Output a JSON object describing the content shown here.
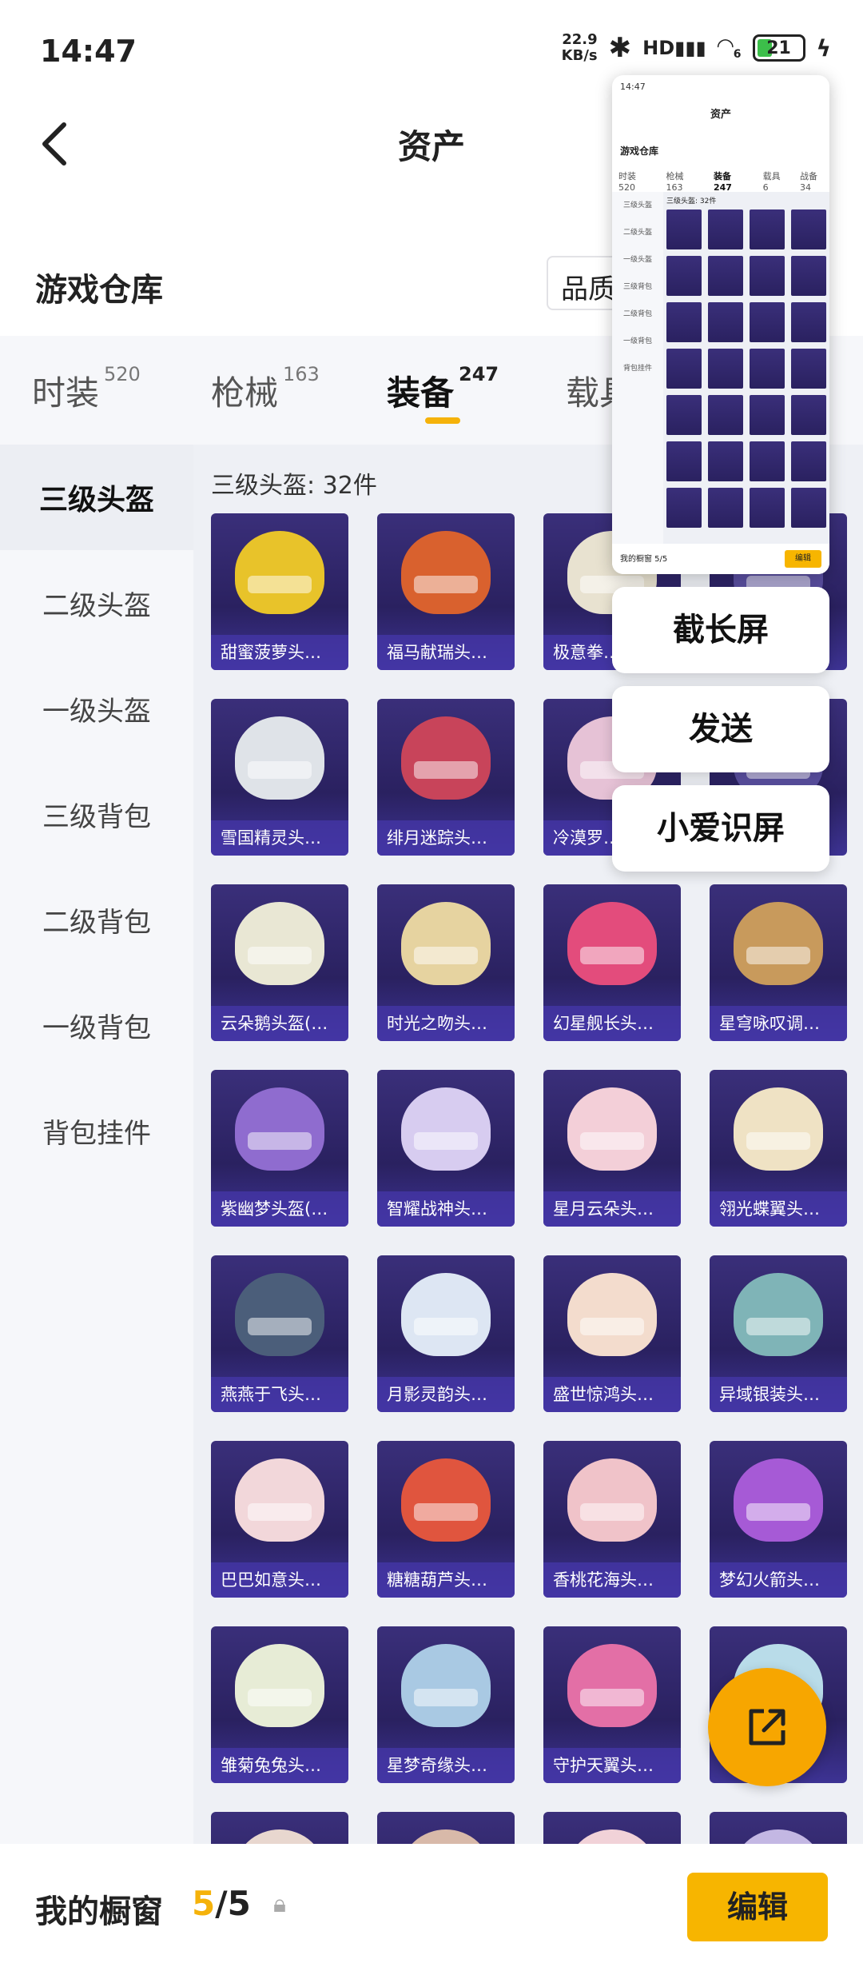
{
  "status_bar": {
    "time": "14:47",
    "speed": "22.9",
    "speed_unit": "KB/s",
    "signal_label": "HD",
    "wifi_label": "6",
    "battery": "21"
  },
  "header": {
    "title": "资产"
  },
  "warehouse": {
    "title": "游戏仓库",
    "quality_label": "品质"
  },
  "tabs": [
    {
      "label": "时装",
      "count": "520"
    },
    {
      "label": "枪械",
      "count": "163"
    },
    {
      "label": "装备",
      "count": "247"
    },
    {
      "label": "载具",
      "count": ""
    }
  ],
  "sidebar": {
    "items": [
      "三级头盔",
      "二级头盔",
      "一级头盔",
      "三级背包",
      "二级背包",
      "一级背包",
      "背包挂件"
    ]
  },
  "content": {
    "count_label": "三级头盔: 32件",
    "items": [
      {
        "name": "甜蜜菠萝头…",
        "color": "#e8c32a"
      },
      {
        "name": "福马献瑞头…",
        "color": "#d9612e"
      },
      {
        "name": "极意拳…",
        "color": "#e8e2d0"
      },
      {
        "name": "",
        "color": "#5a4fa0"
      },
      {
        "name": "雪国精灵头…",
        "color": "#dfe3e8"
      },
      {
        "name": "绯月迷踪头…",
        "color": "#c8445a"
      },
      {
        "name": "冷漠罗…",
        "color": "#e6c2d6"
      },
      {
        "name": "",
        "color": "#5a4fa0"
      },
      {
        "name": "云朵鹅头盔(…",
        "color": "#e9e7d4"
      },
      {
        "name": "时光之吻头…",
        "color": "#e6d3a0"
      },
      {
        "name": "幻星舰长头…",
        "color": "#e34c7c"
      },
      {
        "name": "星穹咏叹调…",
        "color": "#c89a5c"
      },
      {
        "name": "紫幽梦头盔(…",
        "color": "#8f6ccf"
      },
      {
        "name": "智耀战神头…",
        "color": "#d7ccf0"
      },
      {
        "name": "星月云朵头…",
        "color": "#f3cfd8"
      },
      {
        "name": "翎光蝶翼头…",
        "color": "#efe2c4"
      },
      {
        "name": "燕燕于飞头…",
        "color": "#4b5e7a"
      },
      {
        "name": "月影灵韵头…",
        "color": "#dde6f3"
      },
      {
        "name": "盛世惊鸿头…",
        "color": "#f3dccd"
      },
      {
        "name": "异域银装头…",
        "color": "#7fb4b7"
      },
      {
        "name": "巴巴如意头…",
        "color": "#f2d7da"
      },
      {
        "name": "糖糖葫芦头…",
        "color": "#e0553e"
      },
      {
        "name": "香桃花海头…",
        "color": "#f0c3c9"
      },
      {
        "name": "梦幻火箭头…",
        "color": "#a65ad6"
      },
      {
        "name": "雏菊兔兔头…",
        "color": "#e7ecd6"
      },
      {
        "name": "星梦奇缘头…",
        "color": "#a9c9e3"
      },
      {
        "name": "守护天翼头…",
        "color": "#e36fa6"
      },
      {
        "name": "",
        "color": "#b9dce9"
      },
      {
        "name": "",
        "color": "#e8d7cf"
      },
      {
        "name": "",
        "color": "#d8b9a9"
      },
      {
        "name": "",
        "color": "#f1d2d8"
      },
      {
        "name": "",
        "color": "#c3b7e3"
      }
    ]
  },
  "bottom": {
    "label": "我的橱窗",
    "current": "5",
    "total": "/5",
    "edit_label": "编辑"
  },
  "overlay": {
    "preview": {
      "time": "14:47",
      "title": "资产",
      "warehouse": "游戏仓库",
      "tabs": [
        "时装 520",
        "枪械 163",
        "装备 247",
        "载具 6",
        "战备 34"
      ],
      "sidebar": [
        "三级头盔",
        "二级头盔",
        "一级头盔",
        "三级背包",
        "二级背包",
        "一级背包",
        "背包挂件"
      ],
      "count": "三级头盔: 32件",
      "bottom": "我的橱窗 5/5",
      "edit": "编辑"
    },
    "actions": [
      "截长屏",
      "发送",
      "小爱识屏"
    ]
  },
  "colors": {
    "accent": "#f7b500",
    "card_bg": "#2a2160"
  }
}
